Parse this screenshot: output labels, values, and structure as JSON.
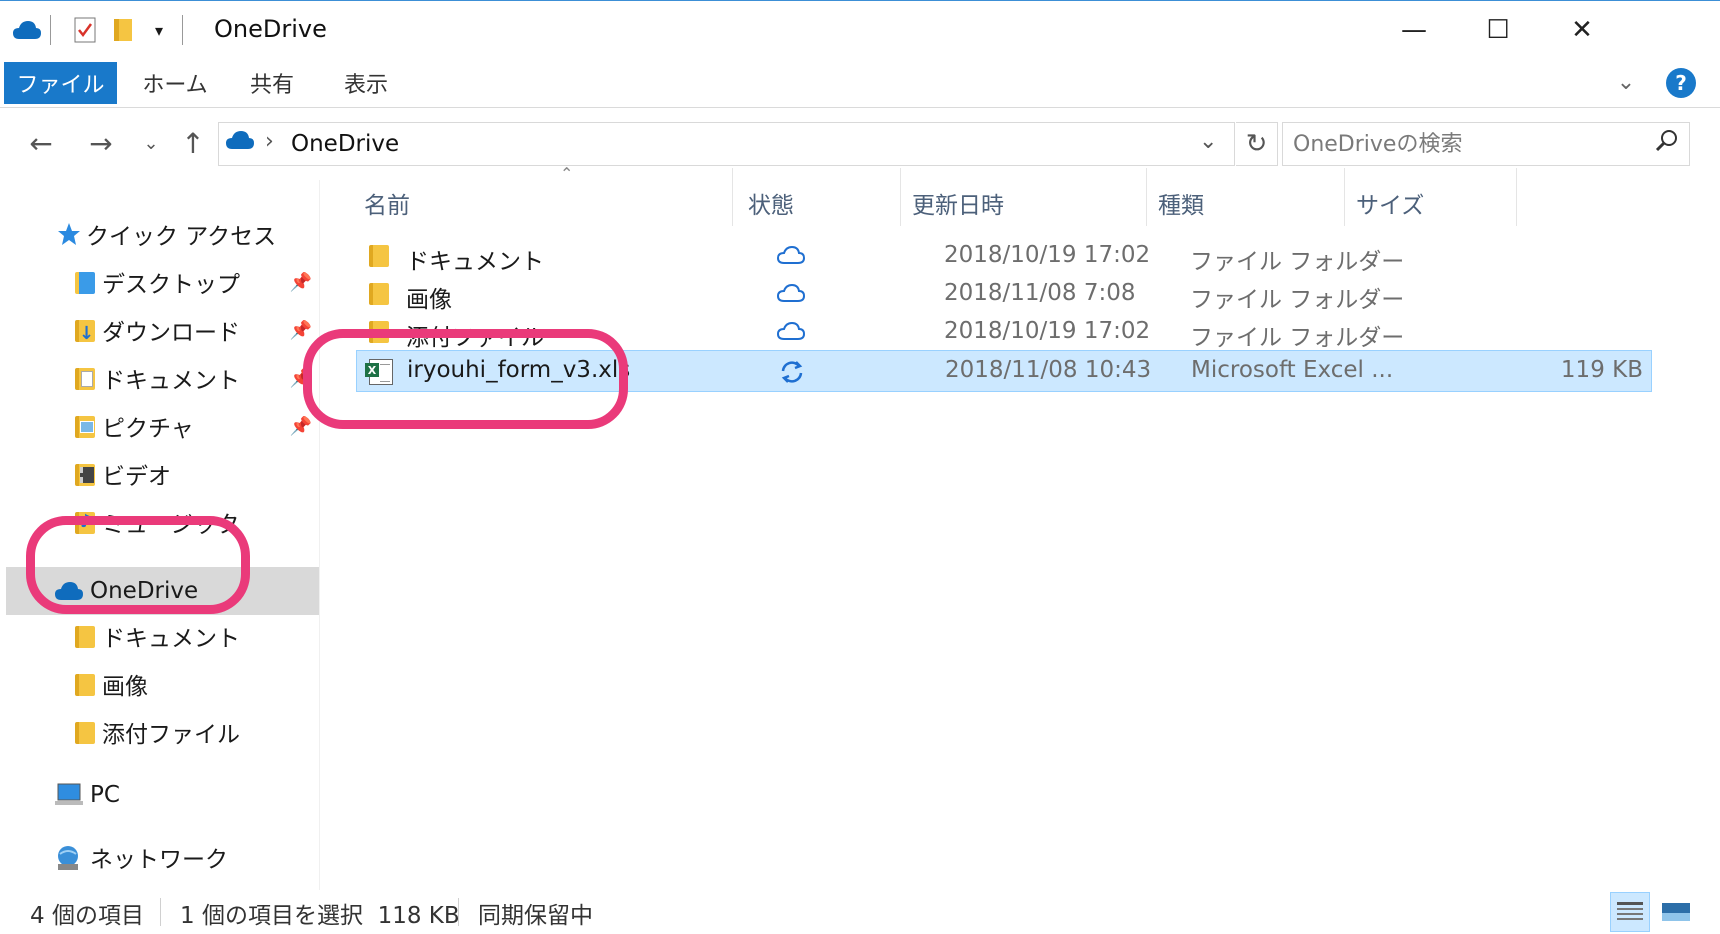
{
  "window": {
    "title": "OneDrive",
    "minimize_glyph": "—",
    "maximize_glyph": "☐",
    "close_glyph": "✕"
  },
  "ribbon": {
    "tabs": [
      "ファイル",
      "ホーム",
      "共有",
      "表示"
    ],
    "help_glyph": "?"
  },
  "navigation": {
    "address_path": "OneDrive",
    "search_placeholder": "OneDriveの検索"
  },
  "sidebar": {
    "quick_access": "クイック アクセス",
    "items": [
      {
        "label": "デスクトップ",
        "icon": "desktop-folder-icon",
        "pinned": true
      },
      {
        "label": "ダウンロード",
        "icon": "downloads-folder-icon",
        "pinned": true
      },
      {
        "label": "ドキュメント",
        "icon": "documents-folder-icon",
        "pinned": true
      },
      {
        "label": "ピクチャ",
        "icon": "pictures-folder-icon",
        "pinned": true
      },
      {
        "label": "ビデオ",
        "icon": "videos-folder-icon",
        "pinned": false
      },
      {
        "label": "ミュージック",
        "icon": "music-folder-icon",
        "pinned": false
      }
    ],
    "onedrive": "OneDrive",
    "onedrive_children": [
      "ドキュメント",
      "画像",
      "添付ファイル"
    ],
    "pc": "PC",
    "network": "ネットワーク"
  },
  "columns": {
    "name": "名前",
    "status": "状態",
    "modified": "更新日時",
    "type": "種類",
    "size": "サイズ"
  },
  "files": [
    {
      "name": "ドキュメント",
      "status": "cloud-icon",
      "modified": "2018/10/19 17:02",
      "type": "ファイル フォルダー",
      "size": ""
    },
    {
      "name": "画像",
      "status": "cloud-icon",
      "modified": "2018/11/08 7:08",
      "type": "ファイル フォルダー",
      "size": ""
    },
    {
      "name": "添付ファイル",
      "status": "cloud-icon",
      "modified": "2018/10/19 17:02",
      "type": "ファイル フォルダー",
      "size": ""
    },
    {
      "name": "iryouhi_form_v3.xls",
      "status": "sync-icon",
      "modified": "2018/11/08 10:43",
      "type": "Microsoft Excel ...",
      "size": "119 KB"
    }
  ],
  "statusbar": {
    "item_count": "4 個の項目",
    "selection": "1 個の項目を選択  118 KB",
    "sync_state": "同期保留中"
  },
  "colors": {
    "accent": "#1979ca",
    "selection": "#cce8ff",
    "highlight_ring": "#ea3a7a",
    "onedrive_blue": "#0f6cbd"
  }
}
